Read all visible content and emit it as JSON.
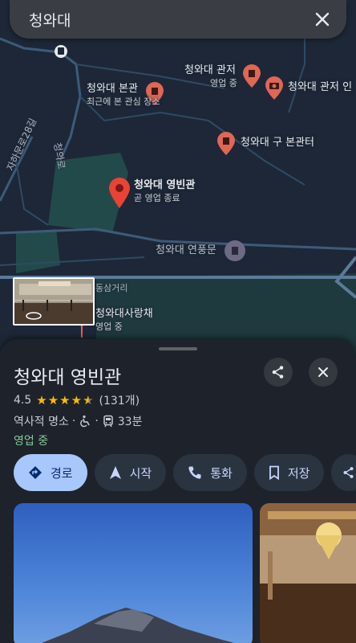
{
  "search": {
    "query": "청와대"
  },
  "map": {
    "pins": [
      {
        "name": "청와대 본관",
        "sub": "최근에 본 관심 장소"
      },
      {
        "name": "청와대 관저",
        "sub": "영업 중"
      },
      {
        "name": "청와대 관저 인"
      },
      {
        "name": "청와대 구 본관터"
      },
      {
        "name": "청와대 영빈관",
        "sub": "곧 영업 종료"
      },
      {
        "name": "청와대 연풍문"
      },
      {
        "name": "청와대사랑채",
        "sub": "영업 중"
      }
    ],
    "roads": [
      "자하문로28길",
      "청의로",
      "동삼거리"
    ]
  },
  "place": {
    "title": "청와대 영빈관",
    "rating": "4.5",
    "stars": "★★★★",
    "review_count": "(131개)",
    "category": "역사적 명소",
    "dot1": "·",
    "dot2": "·",
    "transit_time": "33분",
    "status": "영업 중"
  },
  "actions": {
    "directions": "경로",
    "start": "시작",
    "call": "통화",
    "save": "저장"
  },
  "colors": {
    "accent": "#a8c7fa",
    "pin": "#e06655",
    "open": "#81c995",
    "star": "#fbbc04"
  }
}
